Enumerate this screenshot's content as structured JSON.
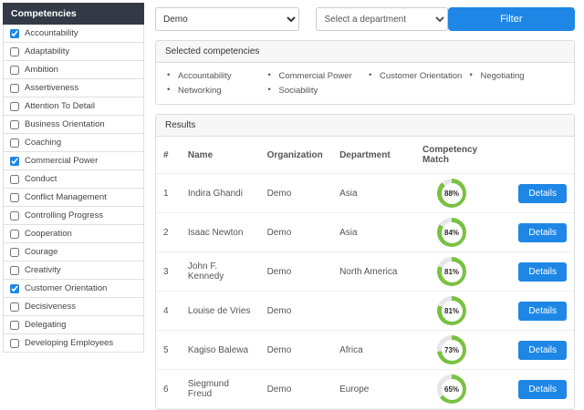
{
  "colors": {
    "accent_blue": "#1e87e5",
    "ring_green": "#7ac143",
    "ring_track": "#e4e6e8",
    "sidebar_header_bg": "#333a45"
  },
  "sidebar": {
    "title": "Competencies",
    "items": [
      {
        "label": "Accountability",
        "checked": true
      },
      {
        "label": "Adaptability",
        "checked": false
      },
      {
        "label": "Ambition",
        "checked": false
      },
      {
        "label": "Assertiveness",
        "checked": false
      },
      {
        "label": "Attention To Detail",
        "checked": false
      },
      {
        "label": "Business Orientation",
        "checked": false
      },
      {
        "label": "Coaching",
        "checked": false
      },
      {
        "label": "Commercial Power",
        "checked": true
      },
      {
        "label": "Conduct",
        "checked": false
      },
      {
        "label": "Conflict Management",
        "checked": false
      },
      {
        "label": "Controlling Progress",
        "checked": false
      },
      {
        "label": "Cooperation",
        "checked": false
      },
      {
        "label": "Courage",
        "checked": false
      },
      {
        "label": "Creativity",
        "checked": false
      },
      {
        "label": "Customer Orientation",
        "checked": true
      },
      {
        "label": "Decisiveness",
        "checked": false
      },
      {
        "label": "Delegating",
        "checked": false
      },
      {
        "label": "Developing Employees",
        "checked": false
      }
    ]
  },
  "toolbar": {
    "organization_value": "Demo",
    "department_placeholder": "Select a department",
    "filter_label": "Filter"
  },
  "selected": {
    "title": "Selected competencies",
    "items": [
      "Accountability",
      "Commercial Power",
      "Customer Orientation",
      "Negotiating",
      "Networking",
      "Sociability"
    ]
  },
  "results": {
    "title": "Results",
    "columns": [
      "#",
      "Name",
      "Organization",
      "Department",
      "Competency Match"
    ],
    "details_label": "Details",
    "rows": [
      {
        "num": 1,
        "name": "Indira Ghandi",
        "org": "Demo",
        "dept": "Asia",
        "match": 88
      },
      {
        "num": 2,
        "name": "Isaac Newton",
        "org": "Demo",
        "dept": "Asia",
        "match": 84
      },
      {
        "num": 3,
        "name": "John F. Kennedy",
        "org": "Demo",
        "dept": "North America",
        "match": 81
      },
      {
        "num": 4,
        "name": "Louise de Vries",
        "org": "Demo",
        "dept": "",
        "match": 81
      },
      {
        "num": 5,
        "name": "Kagiso Balewa",
        "org": "Demo",
        "dept": "Africa",
        "match": 73
      },
      {
        "num": 6,
        "name": "Siegmund Freud",
        "org": "Demo",
        "dept": "Europe",
        "match": 65
      }
    ]
  }
}
